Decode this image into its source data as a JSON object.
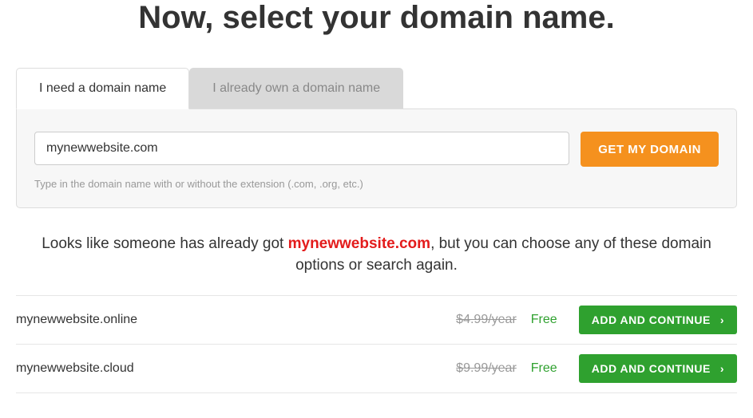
{
  "title": "Now, select your domain name.",
  "tabs": {
    "need": "I need a domain name",
    "own": "I already own a domain name"
  },
  "search": {
    "value": "mynewwebsite.com",
    "button": "GET MY DOMAIN",
    "hint": "Type in the domain name with or without the extension (.com, .org, etc.)"
  },
  "notice": {
    "prefix": "Looks like someone has already got ",
    "taken": "mynewwebsite.com",
    "suffix": ", but you can choose any of these domain options or search again."
  },
  "results": [
    {
      "domain": "mynewwebsite.online",
      "oldPrice": "$4.99/year",
      "price": "Free",
      "cta": "ADD AND CONTINUE"
    },
    {
      "domain": "mynewwebsite.cloud",
      "oldPrice": "$9.99/year",
      "price": "Free",
      "cta": "ADD AND CONTINUE"
    }
  ]
}
